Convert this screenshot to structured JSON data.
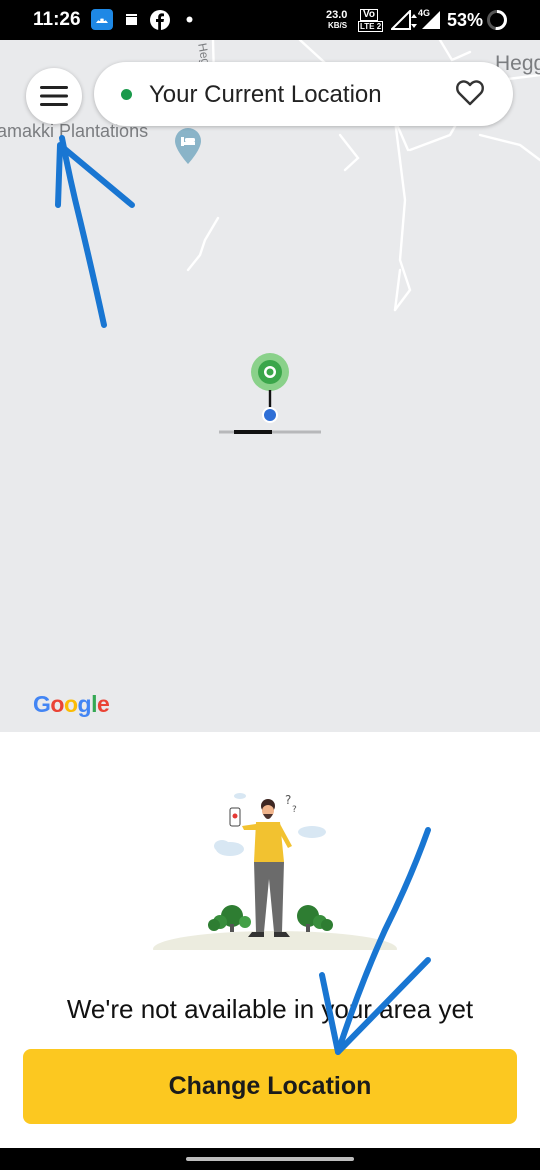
{
  "status_bar": {
    "time": "11:26",
    "net_speed_value": "23.0",
    "net_speed_unit": "KB/S",
    "volte_top": "Vo",
    "volte_bottom": "LTE 2",
    "network": "4G",
    "battery": "53%"
  },
  "map": {
    "search": {
      "label": "Your Current Location"
    },
    "labels": {
      "plantations": "amakki Plantations",
      "hegg": "Hegg",
      "road": "Hegg"
    },
    "google_logo": [
      "G",
      "o",
      "o",
      "g",
      "l",
      "e"
    ],
    "google_colors": [
      "#4285F4",
      "#EA4335",
      "#FBBC05",
      "#4285F4",
      "#34A853",
      "#EA4335"
    ]
  },
  "sheet": {
    "message": "We're not available in your area yet",
    "button": "Change Location",
    "button_color": "#FCC820"
  },
  "annotations": {
    "arrow_color": "#1976D2"
  }
}
